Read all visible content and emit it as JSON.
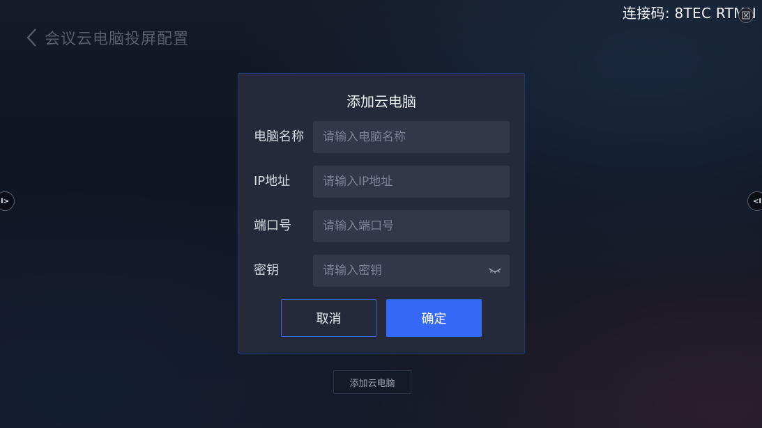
{
  "header": {
    "title": "会议云电脑投屏配置",
    "back_icon": "chevron-left-icon"
  },
  "connection": {
    "code_text": "连接码: 8TEC RTMN",
    "close_icon": "close-icon"
  },
  "side_handles": {
    "left_glyph": "I>",
    "right_glyph": "<I"
  },
  "dialog": {
    "title": "添加云电脑",
    "fields": [
      {
        "label": "电脑名称",
        "placeholder": "请输入电脑名称",
        "value": ""
      },
      {
        "label": "IP地址",
        "placeholder": "请输入IP地址",
        "value": ""
      },
      {
        "label": "端口号",
        "placeholder": "请输入端口号",
        "value": ""
      },
      {
        "label": "密钥",
        "placeholder": "请输入密钥",
        "value": "",
        "icon": "eye-closed-icon"
      }
    ],
    "cancel_label": "取消",
    "confirm_label": "确定"
  },
  "add_button_label": "添加云电脑",
  "colors": {
    "accent": "#3568f5",
    "dialog_bg": "#252a3b",
    "input_bg": "#32374a",
    "border_accent": "#3e64c8"
  }
}
